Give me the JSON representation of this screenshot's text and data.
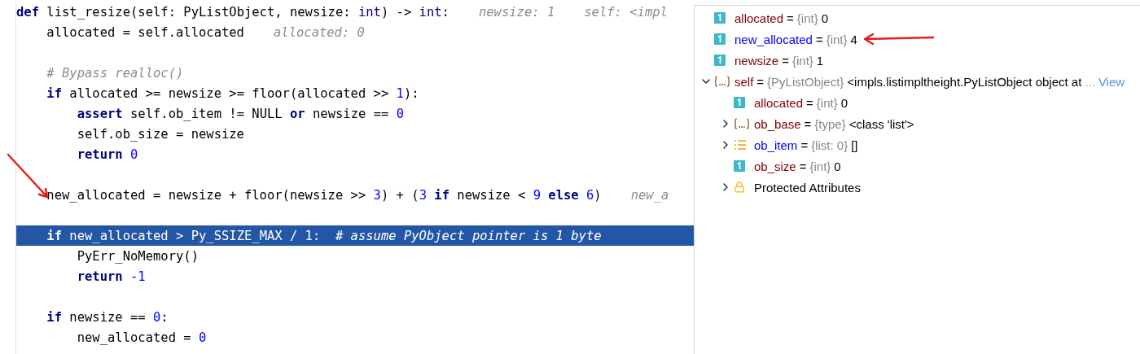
{
  "editor": {
    "lines": [
      {
        "kind": "code",
        "highlighted": false,
        "tokens": [
          {
            "kind": "keyword",
            "text": "def"
          },
          {
            "kind": "plain",
            "text": " list_resize(self: PyListObject, newsize: "
          },
          {
            "kind": "builtin",
            "text": "int"
          },
          {
            "kind": "plain",
            "text": ") -> "
          },
          {
            "kind": "builtin",
            "text": "int"
          },
          {
            "kind": "plain",
            "text": ":"
          },
          {
            "kind": "hint",
            "text": "newsize: 1"
          },
          {
            "kind": "hint",
            "text": "self: <impl"
          }
        ]
      },
      {
        "kind": "code",
        "highlighted": false,
        "tokens": [
          {
            "kind": "plain",
            "text": "    allocated = self.allocated"
          },
          {
            "kind": "hint",
            "text": "allocated: 0"
          }
        ]
      },
      {
        "kind": "blank"
      },
      {
        "kind": "code",
        "highlighted": false,
        "tokens": [
          {
            "kind": "comment",
            "text": "    # Bypass realloc()"
          }
        ]
      },
      {
        "kind": "code",
        "highlighted": false,
        "tokens": [
          {
            "kind": "keyword",
            "text": "    if"
          },
          {
            "kind": "plain",
            "text": " allocated >= newsize >= floor(allocated >> "
          },
          {
            "kind": "number",
            "text": "1"
          },
          {
            "kind": "plain",
            "text": "):"
          }
        ]
      },
      {
        "kind": "code",
        "highlighted": false,
        "tokens": [
          {
            "kind": "keyword",
            "text": "        assert"
          },
          {
            "kind": "plain",
            "text": " self.ob_item != NULL "
          },
          {
            "kind": "keyword",
            "text": "or"
          },
          {
            "kind": "plain",
            "text": " newsize == "
          },
          {
            "kind": "number",
            "text": "0"
          }
        ]
      },
      {
        "kind": "code",
        "highlighted": false,
        "tokens": [
          {
            "kind": "plain",
            "text": "        self.ob_size = newsize"
          }
        ]
      },
      {
        "kind": "code",
        "highlighted": false,
        "tokens": [
          {
            "kind": "keyword",
            "text": "        return"
          },
          {
            "kind": "number",
            "text": " 0"
          }
        ]
      },
      {
        "kind": "blank"
      },
      {
        "kind": "code",
        "highlighted": false,
        "tokens": [
          {
            "kind": "plain",
            "text": "    new_allocated = newsize + floor(newsize >> "
          },
          {
            "kind": "number",
            "text": "3"
          },
          {
            "kind": "plain",
            "text": ") + ("
          },
          {
            "kind": "number",
            "text": "3"
          },
          {
            "kind": "keyword",
            "text": " if"
          },
          {
            "kind": "plain",
            "text": " newsize < "
          },
          {
            "kind": "number",
            "text": "9"
          },
          {
            "kind": "keyword",
            "text": " else"
          },
          {
            "kind": "number",
            "text": " 6"
          },
          {
            "kind": "plain",
            "text": ")"
          },
          {
            "kind": "hint",
            "text": "new_a"
          }
        ]
      },
      {
        "kind": "blank"
      },
      {
        "kind": "code",
        "highlighted": true,
        "tokens": [
          {
            "kind": "keyword",
            "text": "    if"
          },
          {
            "kind": "plain",
            "text": " new_allocated > Py_SSIZE_MAX / 1:  "
          },
          {
            "kind": "comment",
            "text": "# assume PyObject pointer is 1 byte"
          }
        ]
      },
      {
        "kind": "code",
        "highlighted": false,
        "tokens": [
          {
            "kind": "plain",
            "text": "        PyErr_NoMemory()"
          }
        ]
      },
      {
        "kind": "code",
        "highlighted": false,
        "tokens": [
          {
            "kind": "keyword",
            "text": "        return"
          },
          {
            "kind": "number",
            "text": " -1"
          }
        ]
      },
      {
        "kind": "blank"
      },
      {
        "kind": "code",
        "highlighted": false,
        "tokens": [
          {
            "kind": "keyword",
            "text": "    if"
          },
          {
            "kind": "plain",
            "text": " newsize == "
          },
          {
            "kind": "number",
            "text": "0"
          },
          {
            "kind": "plain",
            "text": ":"
          }
        ]
      },
      {
        "kind": "code",
        "highlighted": false,
        "tokens": [
          {
            "kind": "plain",
            "text": "        new_allocated = "
          },
          {
            "kind": "number",
            "text": "0"
          }
        ]
      }
    ]
  },
  "variables": [
    {
      "kind": "int",
      "name": "allocated",
      "changed": false,
      "sep": "=",
      "type": "{int}",
      "value": "0"
    },
    {
      "kind": "int",
      "name": "new_allocated",
      "changed": true,
      "sep": "=",
      "type": "{int}",
      "value": "4"
    },
    {
      "kind": "int",
      "name": "newsize",
      "changed": false,
      "sep": "=",
      "type": "{int}",
      "value": "1"
    },
    {
      "kind": "object",
      "name": "self",
      "changed": false,
      "sep": "=",
      "type": "{PyListObject}",
      "value": "<impls.listimpltheight.PyListObject object at",
      "more": "...",
      "link": "View",
      "expanded": true,
      "children": [
        {
          "kind": "int",
          "name": "allocated",
          "changed": false,
          "sep": "=",
          "type": "{int}",
          "value": "0"
        },
        {
          "kind": "object",
          "name": "ob_base",
          "changed": false,
          "sep": "=",
          "type": "{type}",
          "value": "<class 'list'>",
          "expanded": false
        },
        {
          "kind": "list",
          "name": "ob_item",
          "changed": true,
          "sep": "=",
          "type": "{list: 0}",
          "value": "[]",
          "expanded": false
        },
        {
          "kind": "int",
          "name": "ob_size",
          "changed": false,
          "sep": "=",
          "type": "{int}",
          "value": "0"
        },
        {
          "kind": "group",
          "name": "Protected Attributes",
          "expanded": false
        }
      ]
    }
  ]
}
